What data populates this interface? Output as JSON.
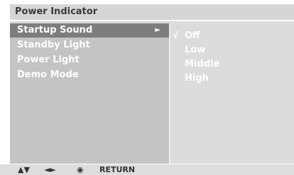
{
  "header": {
    "title": "Power Indicator"
  },
  "menu": {
    "items": [
      {
        "label": "Startup Sound",
        "selected": true
      },
      {
        "label": "Standby Light",
        "selected": false
      },
      {
        "label": "Power Light",
        "selected": false
      },
      {
        "label": "Demo Mode",
        "selected": false
      }
    ],
    "submenu_arrow": "►"
  },
  "options": {
    "items": [
      {
        "label": "Off",
        "checked": true
      },
      {
        "label": "Low",
        "checked": false
      },
      {
        "label": "Middle",
        "checked": false
      },
      {
        "label": "High",
        "checked": false
      }
    ],
    "check_mark": "√"
  },
  "footer": {
    "updown_glyph": "▲▼",
    "leftright_glyph": "◄►",
    "ok_glyph": "◉",
    "return_label": "RETURN"
  },
  "colors": {
    "panel_bg": "#dbdbdb",
    "menu_pane_bg": "#c4c4c4",
    "selected_bg": "#7d7d7d",
    "text": "#ffffff",
    "title_text": "#3a3a3a"
  }
}
